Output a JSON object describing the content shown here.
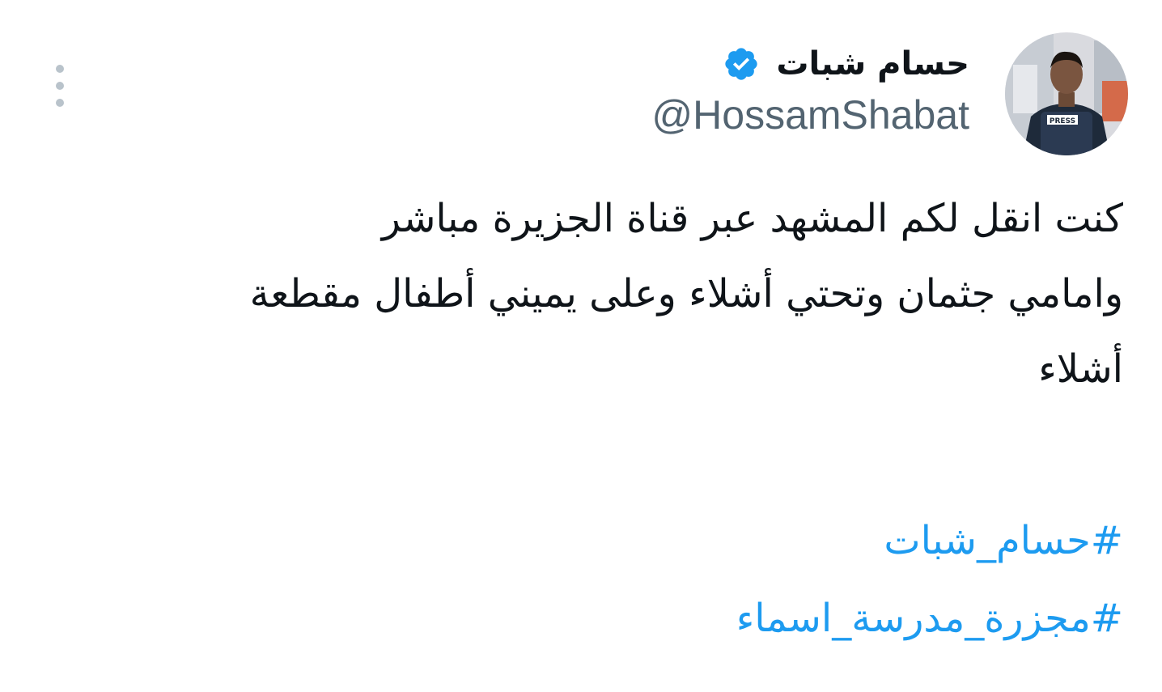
{
  "author": {
    "display_name": "حسام شبات",
    "handle": "@HossamShabat",
    "verified": true,
    "avatar_badge_text": "PRESS"
  },
  "icons": {
    "more": "more-vertical-icon",
    "verified": "verified-badge-icon"
  },
  "tweet": {
    "lines": [
      "كنت انقل لكم المشهد  عبر قناة الجزيرة مباشر",
      "وامامي جثمان وتحتي أشلاء وعلى يميني أطفال مقطعة",
      "أشلاء"
    ],
    "hashtags": [
      "#حسام_شبات",
      "#مجزرة_مدرسة_اسماء"
    ]
  },
  "colors": {
    "text": "#0f1419",
    "handle": "#536471",
    "link": "#1d9bf0",
    "verified": "#1d9bf0",
    "more_dots": "#b9c3cb"
  }
}
